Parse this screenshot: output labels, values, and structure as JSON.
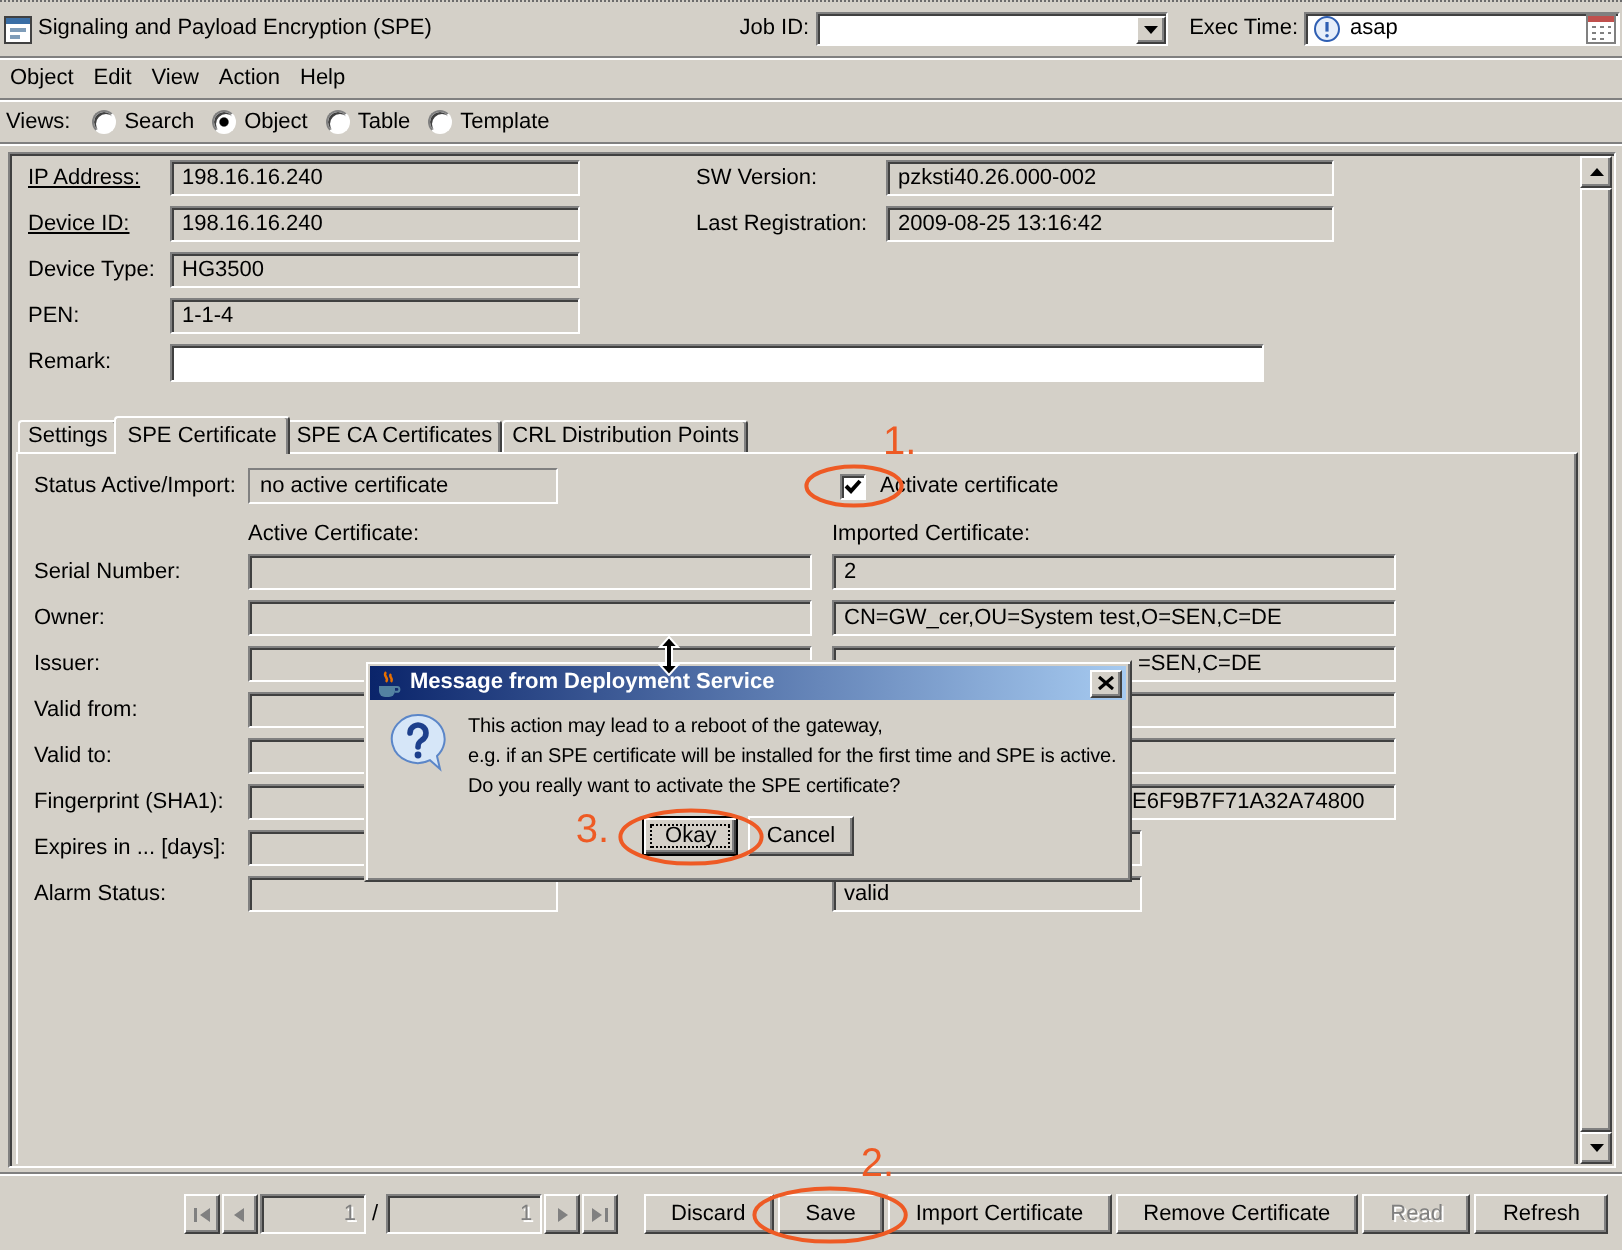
{
  "window": {
    "title": "Signaling and Payload Encryption (SPE)"
  },
  "job_id": {
    "label": "Job ID:"
  },
  "exec_time": {
    "label": "Exec Time:",
    "value": "asap"
  },
  "menu": [
    "Object",
    "Edit",
    "View",
    "Action",
    "Help"
  ],
  "views": {
    "label": "Views:",
    "options": [
      {
        "label": "Search",
        "selected": false
      },
      {
        "label": "Object",
        "selected": true
      },
      {
        "label": "Table",
        "selected": false
      },
      {
        "label": "Template",
        "selected": false
      }
    ]
  },
  "device": {
    "left": [
      {
        "label": "IP Address:",
        "value": "198.16.16.240",
        "underlined": true,
        "editable": false
      },
      {
        "label": "Device ID:",
        "value": "198.16.16.240",
        "underlined": true,
        "editable": false
      },
      {
        "label": "Device Type:",
        "value": "HG3500",
        "underlined": false,
        "editable": false
      },
      {
        "label": "PEN:",
        "value": "1-1-4",
        "underlined": false,
        "editable": false
      }
    ],
    "right": [
      {
        "label": "SW Version:",
        "value": "pzksti40.26.000-002",
        "underlined": false,
        "editable": false
      },
      {
        "label": "Last Registration:",
        "value": "2009-08-25 13:16:42",
        "underlined": false,
        "editable": false
      }
    ],
    "remark": {
      "label": "Remark:",
      "underlined": false,
      "editable": true
    }
  },
  "tabs": [
    {
      "label": "Settings",
      "selected": false
    },
    {
      "label": "SPE Certificate",
      "selected": true
    },
    {
      "label": "SPE CA Certificates",
      "selected": false
    },
    {
      "label": "CRL Distribution Points",
      "selected": false
    }
  ],
  "certificate": {
    "status": {
      "label": "Status Active/Import:",
      "value": "no active certificate"
    },
    "activate": {
      "label": "Activate certificate",
      "checked": true,
      "annotation": {
        "label": "1.",
        "kind": "above"
      }
    },
    "columns": [
      "Active Certificate:",
      "Imported Certificate:"
    ],
    "rows": [
      {
        "label": "Serial Number:",
        "kind": "long",
        "imported": "2"
      },
      {
        "label": "Owner:",
        "kind": "long",
        "imported": "CN=GW_cer,OU=System test,O=SEN,C=DE"
      },
      {
        "label": "Issuer:",
        "kind": "long",
        "imported": "=SEN,C=DE"
      },
      {
        "label": "Valid from:",
        "kind": "long"
      },
      {
        "label": "Valid to:",
        "kind": "long"
      },
      {
        "label": "Fingerprint (SHA1):",
        "kind": "long",
        "imported": "E6F9B7F71A32A74800"
      },
      {
        "label": "Expires in ... [days]:",
        "kind": "short"
      },
      {
        "label": "Alarm Status:",
        "kind": "short",
        "imported": "valid"
      }
    ]
  },
  "toolbar": {
    "pager": {
      "current": "1",
      "separator": "/",
      "total": "1",
      "disabled": true
    },
    "buttons": [
      {
        "label": "Discard",
        "disabled": false
      },
      {
        "label": "Save",
        "disabled": false,
        "annotation": {
          "label": "2.",
          "kind": "above"
        }
      },
      {
        "label": "Import Certificate",
        "disabled": false
      },
      {
        "label": "Remove Certificate",
        "disabled": false
      },
      {
        "label": "Read",
        "disabled": true
      },
      {
        "label": "Refresh",
        "disabled": false
      }
    ]
  },
  "dialog": {
    "title": "Message from Deployment Service",
    "message": [
      "This action may lead to a reboot of the gateway,",
      "e.g. if an SPE certificate will be installed for the first time and SPE is active.",
      "Do you really want to activate the SPE certificate?"
    ],
    "buttons": [
      {
        "label": "Okay",
        "focused": true,
        "annotation": {
          "label": "3.",
          "kind": "left"
        }
      },
      {
        "label": "Cancel",
        "focused": false
      }
    ]
  }
}
